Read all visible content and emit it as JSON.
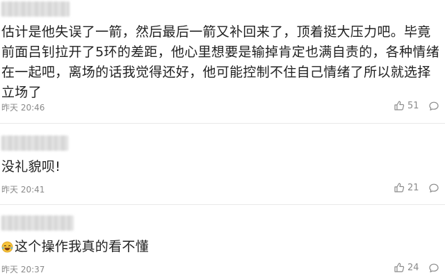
{
  "comments": [
    {
      "text": "估计是他失误了一箭，然后最后一箭又补回来了，顶着挺大压力吧。毕竟前面吕钊拉开了5环的差距，他心里想要是输掉肯定也满自责的，各种情绪在一起吧，离场的话我觉得还好，他可能控制不住自己情绪了所以就选择立场了",
      "time": "昨天 20:46",
      "likes": "51"
    },
    {
      "text": "没礼貌呗!",
      "time": "昨天 20:41",
      "likes": "21"
    },
    {
      "emoji": "laughing-crying-emoji",
      "text": "这个操作我真的看不懂",
      "time": "昨天 20:37",
      "likes": "24"
    }
  ],
  "icons": {
    "like": "thumbs-up-icon",
    "reply": "comment-bubble-icon"
  },
  "colors": {
    "text": "#222222",
    "meta": "#8a8a8a",
    "divider": "#e8e8e8"
  }
}
